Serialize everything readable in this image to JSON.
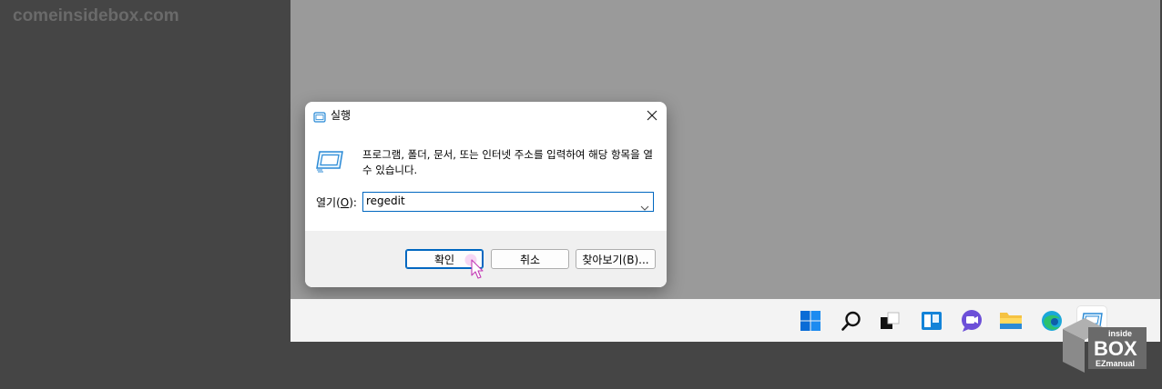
{
  "watermark": "comeinsidebox.com",
  "dialog": {
    "title": "실행",
    "description": "프로그램, 폴더, 문서, 또는 인터넷 주소를 입력하여 해당 항목을 열 수 있습니다.",
    "open_label_prefix": "열기(",
    "open_label_key": "O",
    "open_label_suffix": "):",
    "input_value": "regedit",
    "ok_label": "확인",
    "cancel_label": "취소",
    "browse_label": "찾아보기(B)..."
  },
  "taskbar": {
    "icons": [
      "windows-start-icon",
      "search-icon",
      "task-view-icon",
      "widgets-icon",
      "chat-icon",
      "file-explorer-icon",
      "edge-icon",
      "run-icon"
    ]
  },
  "logo": {
    "line1": "inside",
    "line2": "BOX",
    "line3": "EZmanual"
  },
  "colors": {
    "accent": "#0067c0",
    "desktop": "#9a9a9a",
    "background": "#454545"
  }
}
